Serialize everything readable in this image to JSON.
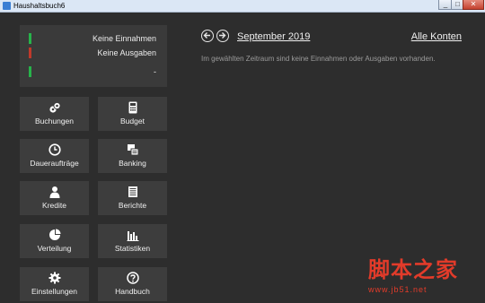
{
  "window": {
    "title": "Haushaltsbuch6",
    "minimize_label": "_",
    "maximize_label": "□",
    "close_label": "✕"
  },
  "summary": {
    "income_label": "Keine Einnahmen",
    "expense_label": "Keine Ausgaben",
    "balance_label": "-",
    "colors": {
      "income": "#27b34a",
      "expense": "#c0392b",
      "balance": "#27b34a"
    }
  },
  "tiles": [
    {
      "label": "Buchungen",
      "icon": "coins-icon"
    },
    {
      "label": "Budget",
      "icon": "calculator-icon"
    },
    {
      "label": "Daueraufträge",
      "icon": "clock-icon"
    },
    {
      "label": "Banking",
      "icon": "bank-transfer-icon"
    },
    {
      "label": "Kredite",
      "icon": "person-icon"
    },
    {
      "label": "Berichte",
      "icon": "report-icon"
    },
    {
      "label": "Verteilung",
      "icon": "pie-chart-icon"
    },
    {
      "label": "Statistiken",
      "icon": "bar-chart-icon"
    },
    {
      "label": "Einstellungen",
      "icon": "gear-icon"
    },
    {
      "label": "Handbuch",
      "icon": "help-icon"
    }
  ],
  "main": {
    "prev_icon": "arrow-left-icon",
    "next_icon": "arrow-right-icon",
    "month": "September 2019",
    "accounts": "Alle Konten",
    "empty_message": "Im gewählten Zeitraum sind keine Einnahmen oder Ausgaben vorhanden."
  },
  "watermark": {
    "text": "脚本之家",
    "url": "www.jb51.net"
  }
}
